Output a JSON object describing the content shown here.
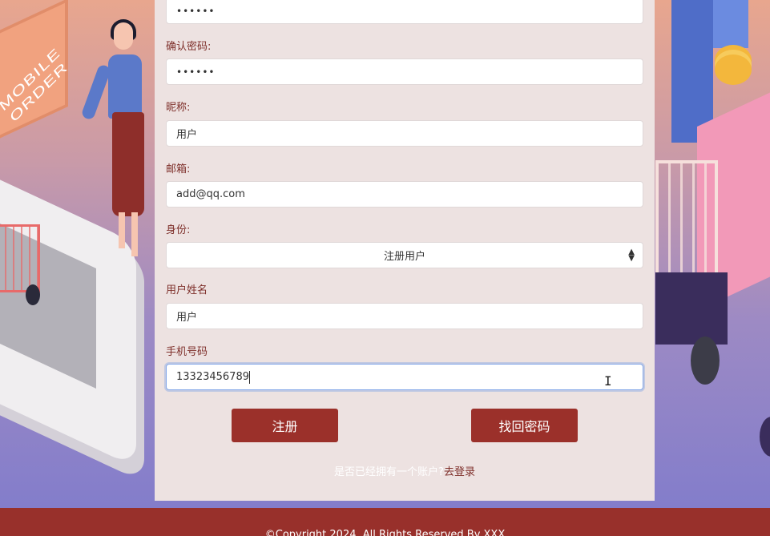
{
  "form": {
    "password_value": "••••••",
    "confirm_password_label": "确认密码:",
    "confirm_password_value": "••••••",
    "nickname_label": "昵称:",
    "nickname_value": "用户",
    "email_label": "邮箱:",
    "email_value": "add@qq.com",
    "identity_label": "身份:",
    "identity_selected": "注册用户",
    "username_label": "用户姓名",
    "username_value": "用户",
    "phone_label": "手机号码",
    "phone_value": "13323456789"
  },
  "buttons": {
    "register_label": "注册",
    "recover_label": "找回密码"
  },
  "login": {
    "question": "是否已经拥有一个账户?",
    "link": "去登录"
  },
  "background": {
    "sign_text": "MOBILE ORDER"
  },
  "footer": {
    "text": "©Copyright 2024. All Rights Reserved By XXX"
  },
  "colors": {
    "primary": "#9b302a",
    "label": "#7e2f2a",
    "panel": "#ede2e1",
    "footer": "#98302b"
  }
}
